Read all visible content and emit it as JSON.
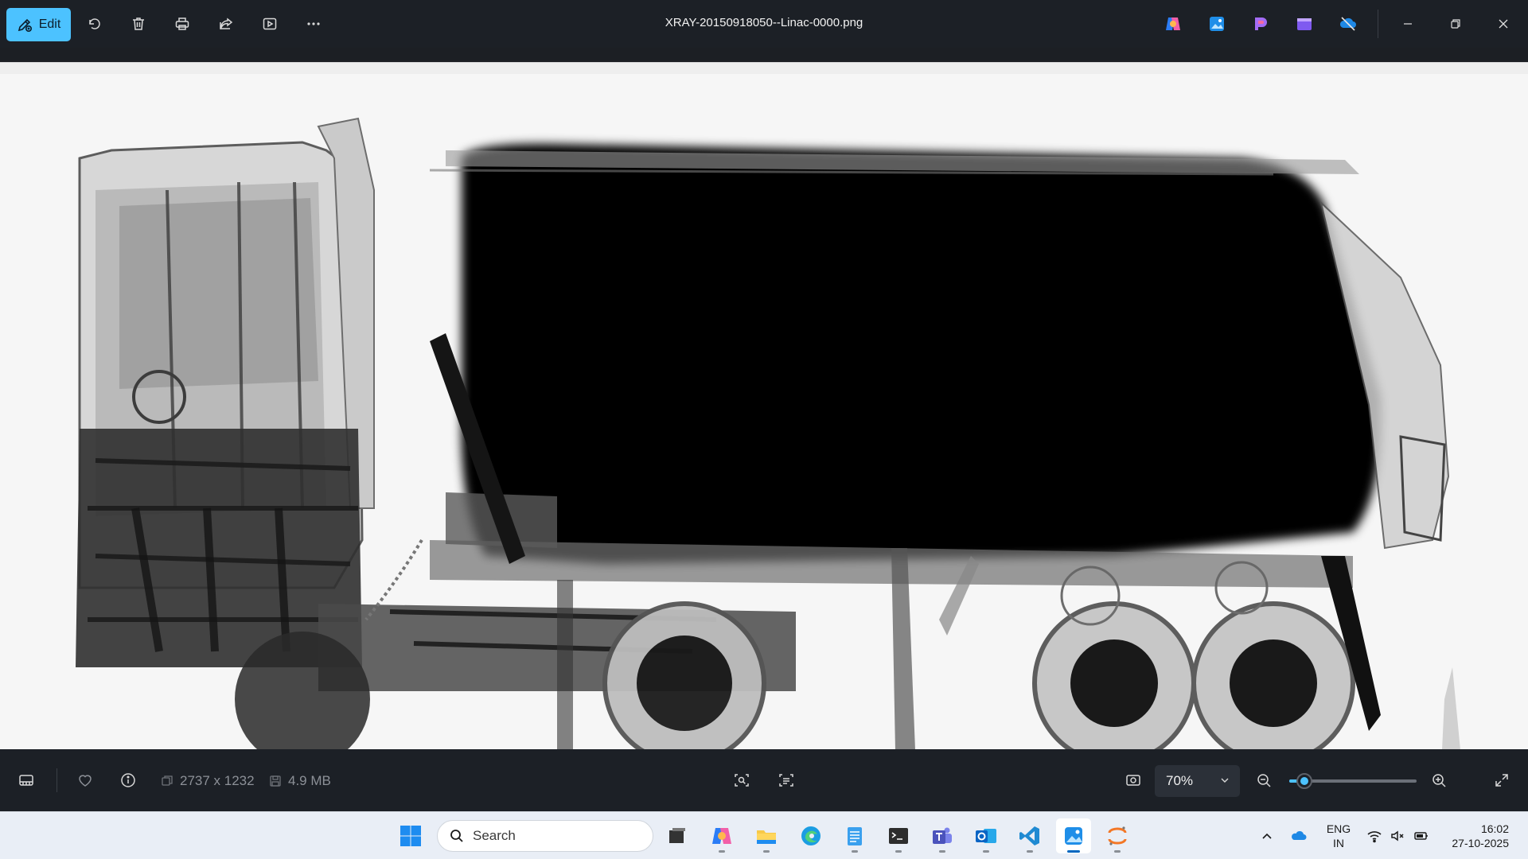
{
  "toolbar": {
    "edit_label": "Edit",
    "icons": [
      "edit-pencil-icon",
      "rotate-icon",
      "delete-icon",
      "print-icon",
      "share-icon",
      "slideshow-icon",
      "more-options-icon"
    ]
  },
  "window": {
    "title": "XRAY-20150918050--Linac-0000.png",
    "app_icons": [
      "copilot-icon",
      "photos-app-icon",
      "paint-app-icon",
      "clipchamp-icon",
      "onedrive-offline-icon"
    ],
    "controls": [
      "minimize-icon",
      "restore-icon",
      "close-icon"
    ]
  },
  "image": {
    "subject": "x-ray scan of truck with trailer",
    "background": "#f6f6f6"
  },
  "status": {
    "dimensions": "2737 x 1232",
    "file_size": "4.9 MB",
    "zoom_value": "70%",
    "zoom_slider_fraction": 0.12
  },
  "taskbar": {
    "search_placeholder": "Search",
    "pinned_apps": [
      "windows-start",
      "task-view",
      "copilot",
      "file-explorer",
      "edge",
      "notepad",
      "terminal",
      "teams",
      "outlook",
      "vscode",
      "photos",
      "jupyter"
    ],
    "active_app": "photos",
    "language_line1": "ENG",
    "language_line2": "IN",
    "time": "16:02",
    "date": "27-10-2025"
  },
  "colors": {
    "accent": "#4cc2ff",
    "chrome": "#1c2026",
    "taskbar": "#e9eef6",
    "active_indicator": "#0067c0"
  }
}
